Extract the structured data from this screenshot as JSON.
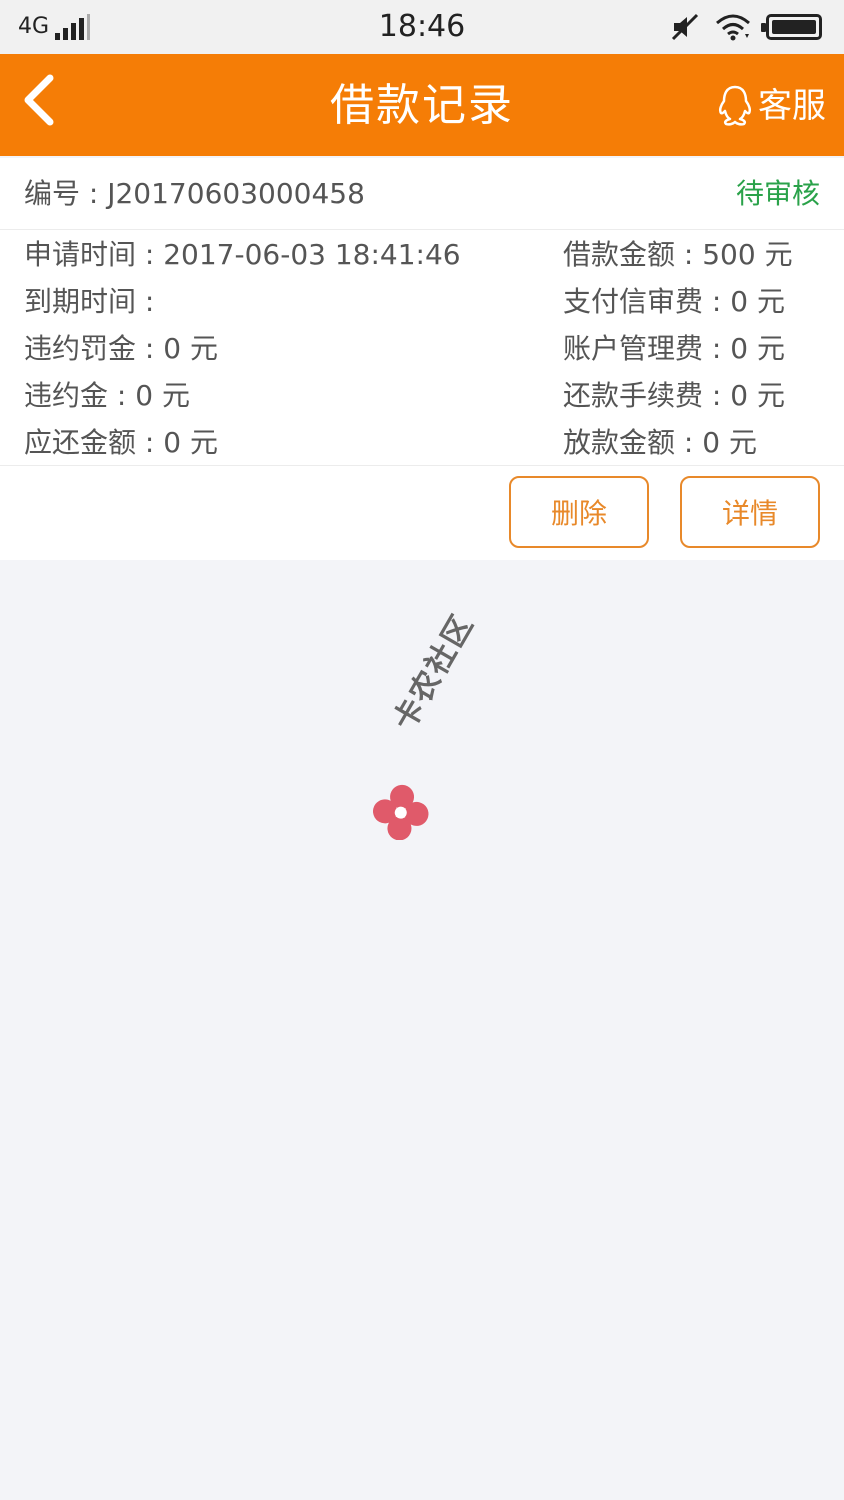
{
  "status_bar": {
    "network": "4G",
    "time": "18:46"
  },
  "header": {
    "title": "借款记录",
    "service_label": "客服"
  },
  "record": {
    "order_id": "编号 : J20170603000458",
    "status": "待审核",
    "rows": [
      {
        "left": "申请时间 : 2017-06-03 18:41:46",
        "right": "借款金额 : 500 元"
      },
      {
        "left": "到期时间 :",
        "right": "支付信审费 : 0 元"
      },
      {
        "left": "违约罚金 : 0 元",
        "right": "账户管理费 : 0 元"
      },
      {
        "left": "违约金 : 0 元",
        "right": "还款手续费 : 0 元"
      },
      {
        "left": "应还金额 : 0 元",
        "right": "放款金额 : 0 元"
      }
    ],
    "delete_label": "删除",
    "detail_label": "详情"
  },
  "watermark": {
    "text": "卡农社区"
  },
  "colors": {
    "accent": "#f57d06",
    "status_green": "#2aa24a",
    "button_border": "#e8892a",
    "background": "#f3f4f8"
  },
  "icons": [
    "back-chevron-icon",
    "qq-penguin-icon",
    "signal-icon",
    "mute-icon",
    "wifi-icon",
    "battery-icon"
  ]
}
